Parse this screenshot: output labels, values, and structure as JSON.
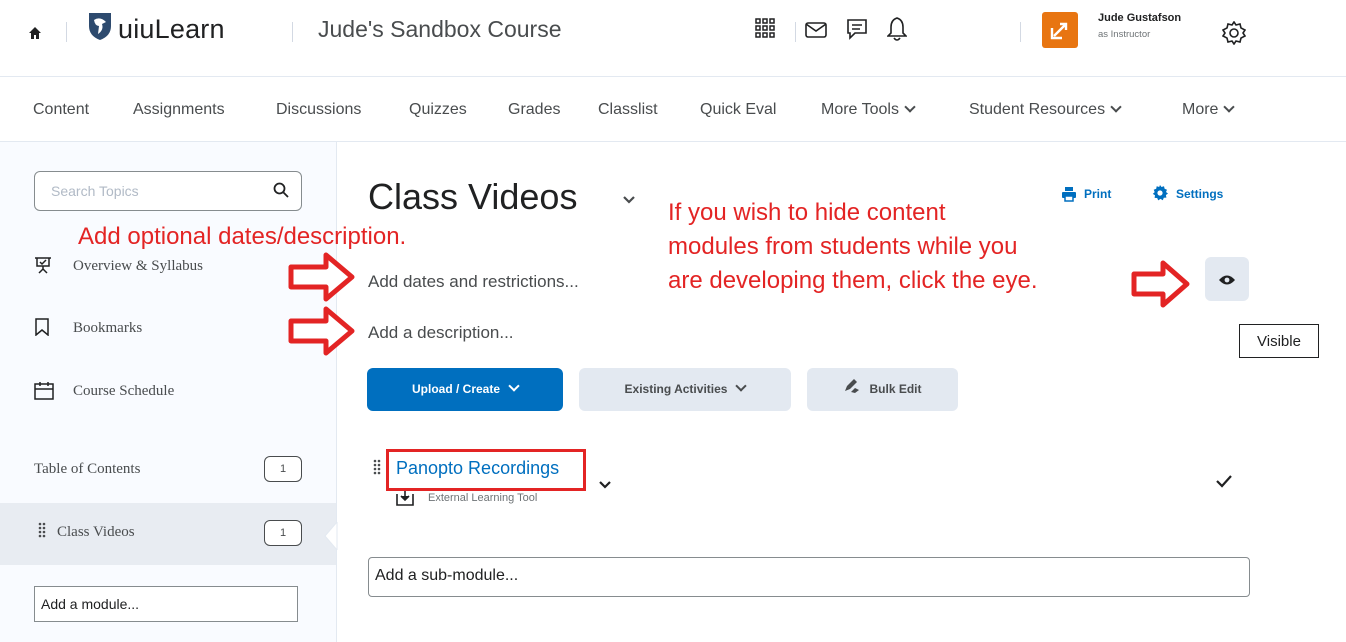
{
  "header": {
    "brand": "uiuLearn",
    "course_title": "Jude's Sandbox Course",
    "user_name": "Jude Gustafson",
    "user_role": "as Instructor",
    "icons": [
      "home-icon",
      "waffle-icon",
      "mail-icon",
      "chat-icon",
      "bell-icon",
      "gear-icon"
    ]
  },
  "nav": {
    "items": [
      "Content",
      "Assignments",
      "Discussions",
      "Quizzes",
      "Grades",
      "Classlist",
      "Quick Eval",
      "More Tools",
      "Student Resources",
      "More"
    ]
  },
  "sidebar": {
    "search_placeholder": "Search Topics",
    "links": [
      "Overview & Syllabus",
      "Bookmarks",
      "Course Schedule"
    ],
    "toc_label": "Table of Contents",
    "toc_count": "1",
    "module_label": "Class Videos",
    "module_count": "1",
    "add_module": "Add a module..."
  },
  "main": {
    "title": "Class Videos",
    "print": "Print",
    "settings": "Settings",
    "add_dates": "Add dates and restrictions...",
    "add_description": "Add a description...",
    "buttons": {
      "upload": "Upload / Create",
      "existing": "Existing Activities",
      "bulk": "Bulk Edit"
    },
    "item_title": "Panopto Recordings",
    "item_type": "External Learning Tool",
    "add_submodule": "Add a sub-module...",
    "tooltip": "Visible"
  },
  "annotations": {
    "left": "Add optional dates/description.",
    "right_line1": "If you wish to hide content",
    "right_line2": "modules from students while you",
    "right_line3": "are developing them, click the eye."
  },
  "colors": {
    "accent": "#006fbf",
    "annotation": "#e32424",
    "avatar": "#e87511",
    "sidebar_bg": "#f9fbff"
  }
}
